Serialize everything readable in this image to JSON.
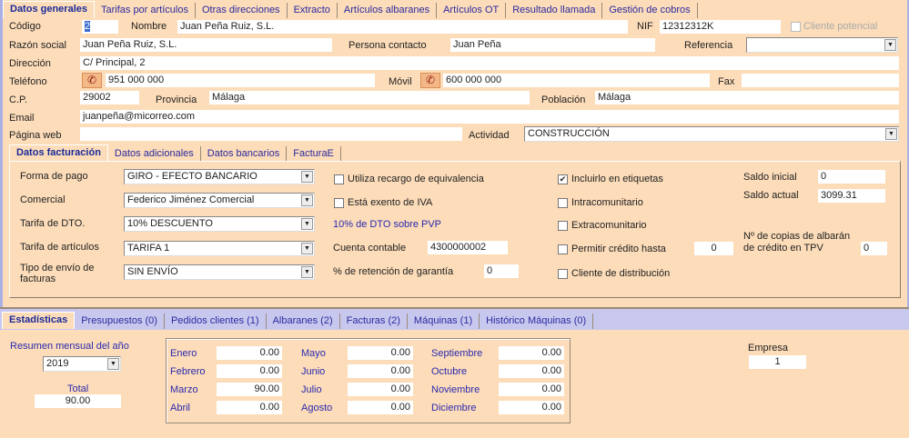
{
  "top_tabs": [
    "Datos generales",
    "Tarifas por artículos",
    "Otras direcciones",
    "Extracto",
    "Artículos albaranes",
    "Artículos OT",
    "Resultado llamada",
    "Gestión de cobros"
  ],
  "general": {
    "codigo_label": "Código",
    "codigo": "2",
    "nombre_label": "Nombre",
    "nombre": "Juan Peña Ruiz, S.L.",
    "nif_label": "NIF",
    "nif": "12312312K",
    "cliente_potencial": "Cliente potencial",
    "razon_label": "Razón social",
    "razon": "Juan Peña Ruiz, S.L.",
    "contacto_label": "Persona contacto",
    "contacto": "Juan Peña",
    "referencia_label": "Referencia",
    "referencia": "",
    "direccion_label": "Dirección",
    "direccion": "C/ Principal, 2",
    "telefono_label": "Teléfono",
    "telefono": "951 000 000",
    "movil_label": "Móvil",
    "movil": "600 000 000",
    "fax_label": "Fax",
    "fax": "",
    "cp_label": "C.P.",
    "cp": "29002",
    "provincia_label": "Provincia",
    "provincia": "Málaga",
    "poblacion_label": "Población",
    "poblacion": "Málaga",
    "email_label": "Email",
    "email": "juanpeña@micorreo.com",
    "web_label": "Página web",
    "web": "",
    "actividad_label": "Actividad",
    "actividad": "CONSTRUCCIÓN"
  },
  "sub_tabs": [
    "Datos facturación",
    "Datos adicionales",
    "Datos bancarios",
    "FacturaE"
  ],
  "facturacion": {
    "forma_pago_label": "Forma de pago",
    "forma_pago": "GIRO - EFECTO BANCARIO",
    "comercial_label": "Comercial",
    "comercial": "Federico Jiménez Comercial",
    "tarifa_dto_label": "Tarifa de DTO.",
    "tarifa_dto": "10% DESCUENTO",
    "tarifa_art_label": "Tarifa de artículos",
    "tarifa_art": "TARIFA 1",
    "envio_label": "Tipo de envío de facturas",
    "envio": "SIN ENVÍO",
    "recargo": "Utiliza recargo de equivalencia",
    "exento": "Está exento de IVA",
    "dto_info": "10% de DTO sobre PVP",
    "cuenta_label": "Cuenta contable",
    "cuenta": "4300000002",
    "retencion_label": "% de retención de garantía",
    "retencion": "0",
    "etiquetas": "Incluirlo en etiquetas",
    "intra": "Intracomunitario",
    "extra": "Extracomunitario",
    "credito": "Permitir crédito hasta",
    "credito_val": "0",
    "distribucion": "Cliente de distribución",
    "saldo_inicial_label": "Saldo inicial",
    "saldo_inicial": "0",
    "saldo_actual_label": "Saldo actual",
    "saldo_actual": "3099.31",
    "copias_label": "Nº de copias de albarán de crédito en TPV",
    "copias": "0"
  },
  "bottom_tabs": [
    "Estadísticas",
    "Presupuestos (0)",
    "Pedidos clientes (1)",
    "Albaranes (2)",
    "Facturas (2)",
    "Máquinas (1)",
    "Histórico Máquinas (0)"
  ],
  "stats": {
    "resumen_label": "Resumen mensual del año",
    "year": "2019",
    "total_label": "Total",
    "total": "90.00",
    "empresa_label": "Empresa",
    "empresa": "1",
    "months": [
      {
        "m": "Enero",
        "v": "0.00"
      },
      {
        "m": "Febrero",
        "v": "0.00"
      },
      {
        "m": "Marzo",
        "v": "90.00"
      },
      {
        "m": "Abril",
        "v": "0.00"
      },
      {
        "m": "Mayo",
        "v": "0.00"
      },
      {
        "m": "Junio",
        "v": "0.00"
      },
      {
        "m": "Julio",
        "v": "0.00"
      },
      {
        "m": "Agosto",
        "v": "0.00"
      },
      {
        "m": "Septiembre",
        "v": "0.00"
      },
      {
        "m": "Octubre",
        "v": "0.00"
      },
      {
        "m": "Noviembre",
        "v": "0.00"
      },
      {
        "m": "Diciembre",
        "v": "0.00"
      }
    ]
  }
}
